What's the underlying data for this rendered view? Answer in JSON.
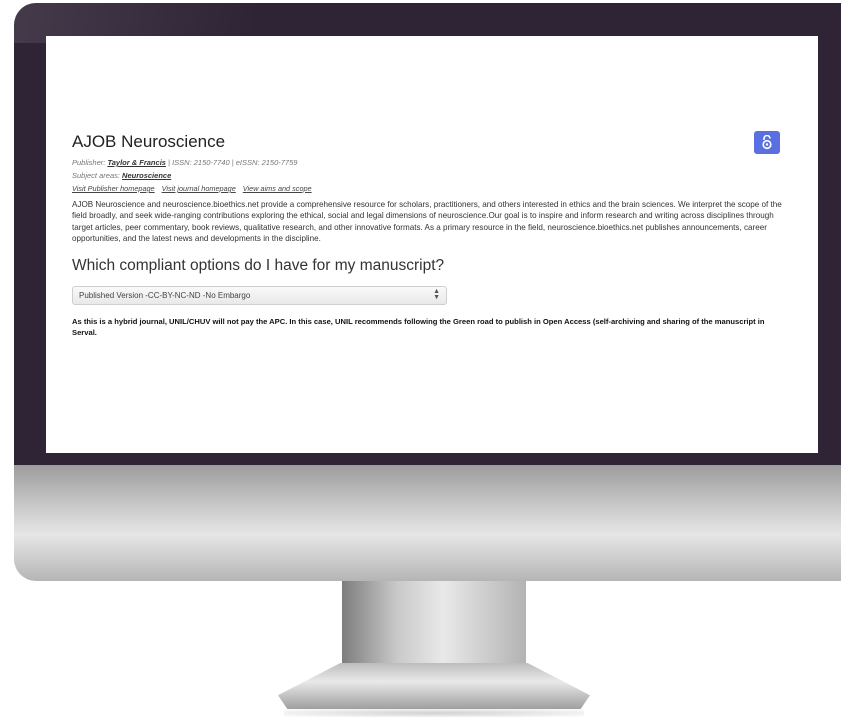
{
  "journal": {
    "title": "AJOB Neuroscience",
    "publisher_label": "Publisher:",
    "publisher": "Taylor & Francis",
    "issn_text": "| ISSN: 2150-7740 | eISSN: 2150-7759",
    "subject_label": "Subject areas:",
    "subject": "Neuroscience",
    "links": [
      "Visit Publisher homepage",
      "Visit journal homepage",
      "View aims and scope"
    ],
    "description": "AJOB Neuroscience and neuroscience.bioethics.net provide a comprehensive resource for scholars, practitioners, and others interested in ethics and the brain sciences. We interpret the scope of the field broadly, and seek wide-ranging contributions exploring the ethical, social and legal dimensions of neuroscience.Our goal is to inspire and inform research and writing across disciplines through target articles, peer commentary, book reviews, qualitative research, and other innovative formats. As a primary resource in the field, neuroscience.bioethics.net publishes announcements, career opportunities, and the latest news and developments in the discipline.",
    "oa_icon": "open-access-icon",
    "oa_color": "#5a6fe0"
  },
  "options": {
    "title": "Which compliant options do I have for my manuscript?",
    "selected": "Published Version -CC-BY-NC-ND -No Embargo",
    "notice": "As this is a hybrid journal, UNIL/CHUV will not pay the APC. In this case, UNIL recommends following the Green road to publish in Open Access (self-archiving and sharing of the manuscript in Serval."
  }
}
